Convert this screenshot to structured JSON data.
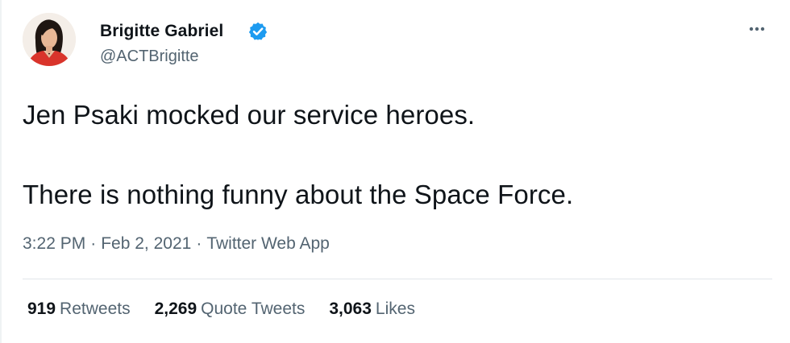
{
  "author": {
    "display_name": "Brigitte Gabriel",
    "handle": "@ACTBrigitte",
    "verified": true
  },
  "tweet": {
    "lines": [
      "Jen Psaki mocked our service heroes.",
      "There is nothing funny about the Space Force."
    ],
    "time": "3:22 PM",
    "date": "Feb 2, 2021",
    "source": "Twitter Web App",
    "separator": "·"
  },
  "stats": {
    "retweets": {
      "count": "919",
      "label": "Retweets"
    },
    "quote_tweets": {
      "count": "2,269",
      "label": "Quote Tweets"
    },
    "likes": {
      "count": "3,063",
      "label": "Likes"
    }
  },
  "icons": {
    "verified": "verified-badge-icon",
    "more": "more-options-icon"
  },
  "colors": {
    "text_primary": "#0f1419",
    "text_secondary": "#536471",
    "verified_blue": "#1d9bf0",
    "divider": "#e1e6ea"
  }
}
